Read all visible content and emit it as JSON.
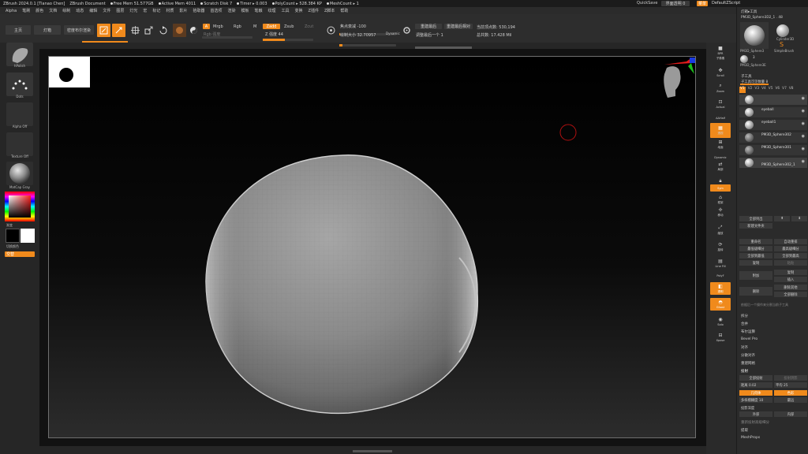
{
  "titlebar": {
    "app": "ZBrush 2024.0.1 [Tianao Chen]",
    "doc": "ZBrush Document",
    "free_mem": "Free Mem 51.577GB",
    "active_mem": "Active Mem 4011",
    "scratch": "Scratch Disk 7",
    "timer": "Timer ▸ 0.003",
    "polycount": "PolyCount ▸ 528.384 KP",
    "meshcount": "MeshCount ▸ 1",
    "quicksave": "QuickSave",
    "transparency": "界面透明 0",
    "menus_btn": "菜单",
    "script": "DefaultZScript"
  },
  "menubar": [
    "Alpha",
    "笔刷",
    "颜色",
    "文档",
    "绘制",
    "动态",
    "编辑",
    "文件",
    "图层",
    "灯光",
    "宏",
    "标记",
    "材质",
    "影片",
    "拾取器",
    "首选项",
    "渲染",
    "模板",
    "笔触",
    "纹理",
    "工具",
    "变换",
    "Z插件",
    "Z脚本",
    "帮助"
  ],
  "toolbar": {
    "home_label": "主页",
    "lightbox_label": "灯箱",
    "spotlight_label": "密度布尔渲染",
    "edit_label": "Edit",
    "draw_label": "Draw",
    "move_label": "Move",
    "scale_label": "Scale",
    "rotate_label": "Rotate",
    "a_label": "A",
    "mrgb_label": "Mrgb",
    "rgb_label": "Rgb",
    "m_label": "M",
    "zadd_label": "Zadd",
    "zsub_label": "Zsub",
    "zcut_label": "Zcut",
    "rgb_intensity": "Rgb 强度",
    "z_intensity": "Z 强度 44",
    "focal_shift": "焦点衰减 -100",
    "draw_size": "绘制大小 32.70957",
    "dynamic": "Dynamic",
    "active_points": "当前顶点数: 530,194",
    "total_points": "总共数: 17.428 Mil",
    "hires_label": "重建最后",
    "hires2_label": "重建最后相对",
    "subdiv_label": "调整最后一个 1"
  },
  "leftshelf": {
    "brush": "hPolish",
    "stroke": "Dots",
    "alpha": "Alpha Off",
    "texture": "Texture Off",
    "material": "MatCap Gray",
    "gradient": "渐变",
    "switch_color": "切换颜色",
    "alternate": "交替"
  },
  "rightshelf": [
    {
      "name": "bpr",
      "label": "BPR"
    },
    {
      "name": "subpixel",
      "label": "子像素"
    },
    {
      "name": "scroll",
      "label": "Scroll"
    },
    {
      "name": "zoom",
      "label": "Zoom"
    },
    {
      "name": "actual",
      "label": "Actual"
    },
    {
      "name": "aahalf",
      "label": "AAHalf"
    },
    {
      "name": "persp",
      "label": "透视"
    },
    {
      "name": "floor",
      "label": "地面"
    },
    {
      "name": "dynamic",
      "label": "Dynamic"
    },
    {
      "name": "local",
      "label": "局部"
    },
    {
      "name": "sym",
      "label": "Sym"
    },
    {
      "name": "frame",
      "label": "框架"
    },
    {
      "name": "move",
      "label": "移动"
    },
    {
      "name": "scale",
      "label": "缩放"
    },
    {
      "name": "rotate",
      "label": "旋转"
    },
    {
      "name": "linefill",
      "label": "Line Fill"
    },
    {
      "name": "polyf",
      "label": "PolyF"
    },
    {
      "name": "transp",
      "label": "透明"
    },
    {
      "name": "ghost",
      "label": "Ghost"
    },
    {
      "name": "solo",
      "label": "Solo"
    },
    {
      "name": "xpose",
      "label": "Xpose"
    }
  ],
  "panel": {
    "header": "灯箱▸工具",
    "tool_name": "PM3D_Sphere3D2_1 . 48",
    "tool1_label": "PM3D_Sphere3",
    "tool2_label": "Cylinder3D",
    "tool3_label": "SimpleBrush",
    "tool4_label": "PM3D_Sphere3E",
    "tool_count": "3",
    "subtool_title": "子工具",
    "subtool_count": "子工具可见数量 8",
    "visibility_tabs": [
      "V1",
      "V2",
      "V3",
      "V4",
      "V5",
      "V6",
      "V7",
      "V8"
    ],
    "subtools": [
      "",
      "eyeball",
      "eyeball1",
      "PM3D_Sphere302",
      "PM3D_Sphere301",
      "PM3D_Sphere302_1"
    ],
    "list_all": "全部列出",
    "new_folder": "新建文件夹",
    "rename": "重命名",
    "auto_reorder": "自动重排",
    "all_low": "最低级细分",
    "all_high": "最高级细分",
    "dup_all": "全部到最低",
    "all_top": "全部到最高",
    "copy": "复制",
    "paste": "粘贴",
    "append": "附加",
    "duplicate": "复制",
    "insert": "插入",
    "delete": "删除",
    "del_other": "删除其他",
    "del_all": "全部删除",
    "split_note": "依据后一个操作来分割当前子工具",
    "split": "拆分",
    "merge": "合并",
    "boolean": "布尔运算",
    "bevel_pro": "Bevel Pro",
    "align": "对齐",
    "distribute": "分散对齐",
    "remesh": "重建网格",
    "project": "投射",
    "project_all": "全部投射",
    "project_shadow": "投射阴影",
    "dist_label": "距离 0.02",
    "mean_label": "平均 25",
    "geometry": "几何体",
    "color": "色彩",
    "pa_blur": "多样模糊度 10",
    "farthest": "最远",
    "outer_label": "内部",
    "inner_label": "外部",
    "reproject": "重新投射高级细分",
    "extract": "投影深度",
    "extract2": "提取",
    "mesh_props": "MeshProps"
  }
}
